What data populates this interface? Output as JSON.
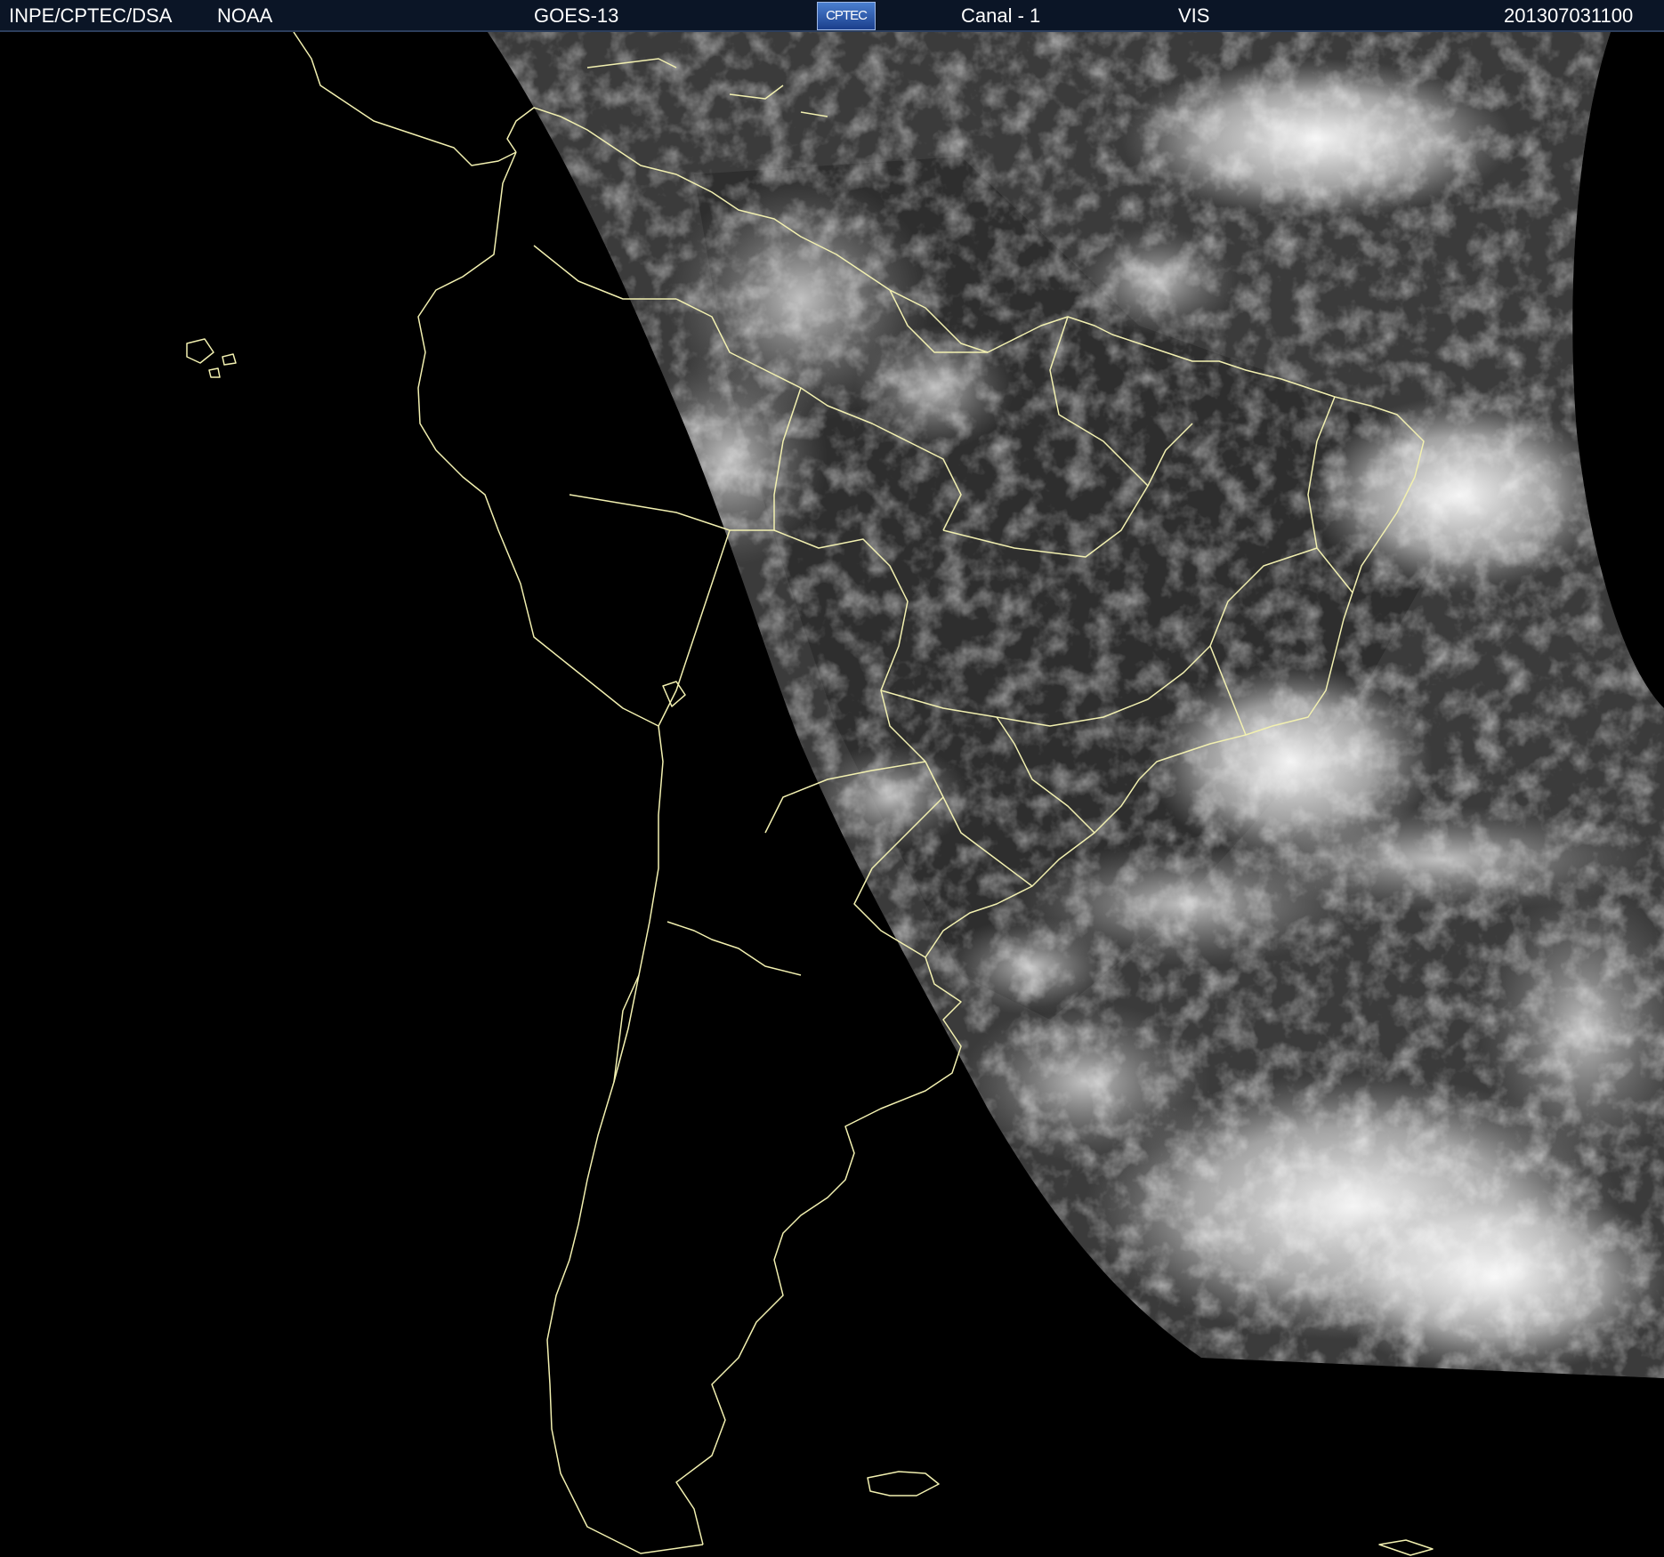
{
  "header": {
    "source": "INPE/CPTEC/DSA",
    "agency": "NOAA",
    "satellite": "GOES-13",
    "logo_text": "CPTEC",
    "channel": "Canal - 1",
    "band": "VIS",
    "timestamp": "201307031100"
  },
  "colors": {
    "header_bg": "#0b1526",
    "coastline": "#f2f0b0",
    "background": "#000000"
  }
}
